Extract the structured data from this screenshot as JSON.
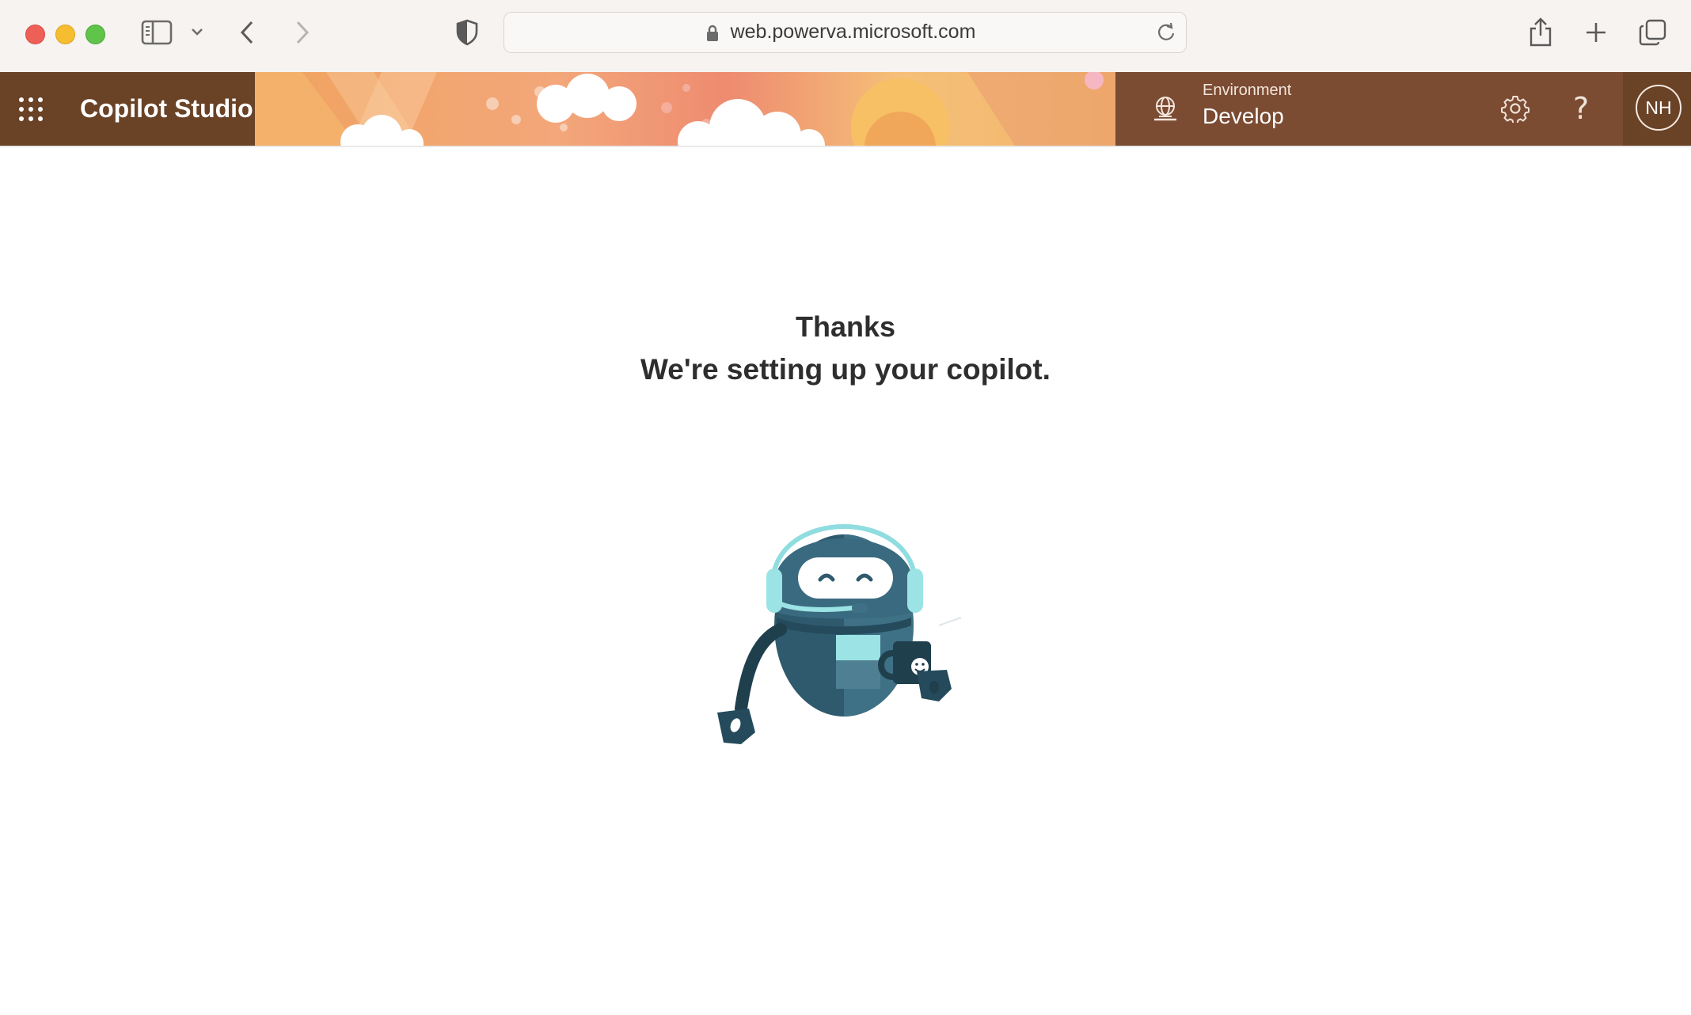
{
  "browser": {
    "url": "web.powerva.microsoft.com",
    "icons": [
      "sidebar-icon",
      "chevron-down-icon",
      "back-icon",
      "forward-icon",
      "shield-icon",
      "lock-icon",
      "reload-icon",
      "share-icon",
      "new-tab-icon",
      "tab-overview-icon"
    ]
  },
  "header": {
    "app_title": "Copilot Studio",
    "environment_label": "Environment",
    "environment_value": "Develop",
    "help_glyph": "?",
    "avatar_initials": "NH",
    "colors": {
      "brand_bg": "#6a4226",
      "env_bg": "#7b4b32",
      "banner_base": "#f2a46c"
    }
  },
  "main": {
    "title": "Thanks",
    "subtitle": "We're setting up your copilot."
  }
}
